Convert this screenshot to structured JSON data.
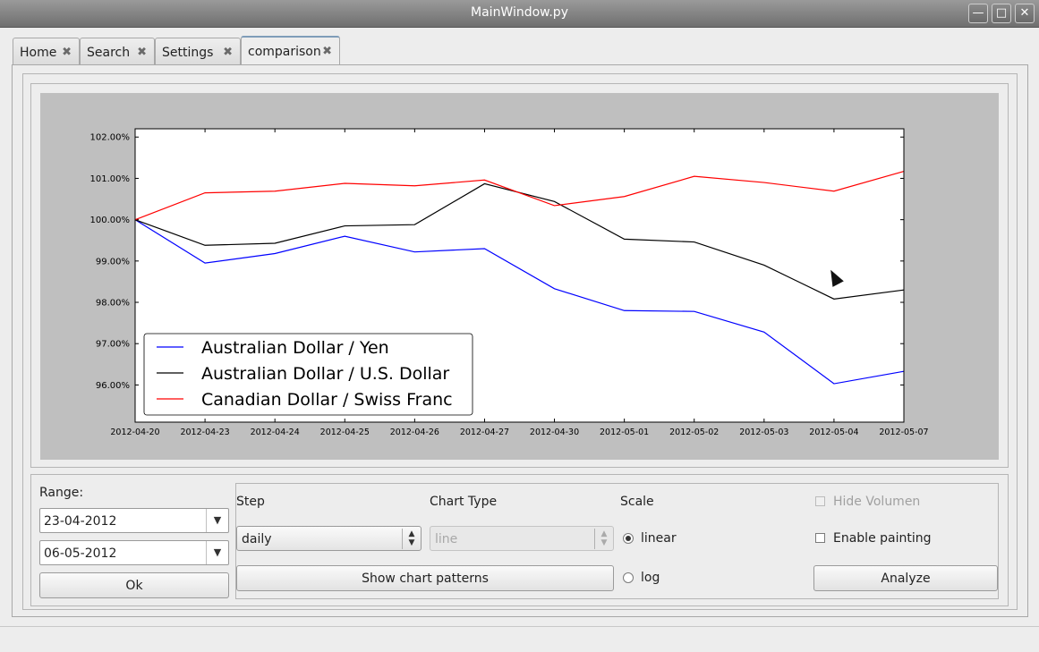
{
  "window": {
    "title": "MainWindow.py",
    "controls": [
      "minimize-icon",
      "maximize-icon",
      "close-icon"
    ]
  },
  "tabs": [
    {
      "label": "Home",
      "active": false
    },
    {
      "label": "Search",
      "active": false
    },
    {
      "label": "Settings",
      "active": false
    },
    {
      "label": "comparison",
      "active": true
    }
  ],
  "chart_data": {
    "type": "line",
    "x": [
      "2012-04-20",
      "2012-04-23",
      "2012-04-24",
      "2012-04-25",
      "2012-04-26",
      "2012-04-27",
      "2012-04-30",
      "2012-05-01",
      "2012-05-02",
      "2012-05-03",
      "2012-05-04",
      "2012-05-07"
    ],
    "yticks": [
      "102.00%",
      "101.00%",
      "100.00%",
      "99.00%",
      "98.00%",
      "97.00%",
      "96.00%"
    ],
    "ylim": [
      95.1,
      102.2
    ],
    "grid": false,
    "legend_position": "lower-left",
    "series": [
      {
        "name": "Australian Dollar / Yen",
        "color": "#0000ff",
        "values": [
          100.0,
          98.95,
          99.18,
          99.6,
          99.22,
          99.3,
          98.33,
          97.8,
          97.78,
          97.28,
          96.03,
          96.33
        ]
      },
      {
        "name": "Australian Dollar / U.S. Dollar",
        "color": "#000000",
        "values": [
          100.0,
          99.38,
          99.43,
          99.85,
          99.88,
          100.87,
          100.44,
          99.53,
          99.46,
          98.9,
          98.08,
          98.3
        ]
      },
      {
        "name": "Canadian Dollar / Swiss Franc",
        "color": "#ff0000",
        "values": [
          100.0,
          100.65,
          100.69,
          100.88,
          100.82,
          100.96,
          100.34,
          100.56,
          101.05,
          100.9,
          100.69,
          101.17
        ]
      }
    ]
  },
  "controls": {
    "range_label": "Range:",
    "range_from": "23-04-2012",
    "range_to": "06-05-2012",
    "ok_label": "Ok",
    "step_label": "Step",
    "step_value": "daily",
    "chart_type_label": "Chart Type",
    "chart_type_value": "line",
    "scale_label": "Scale",
    "scale_options": [
      "linear",
      "log"
    ],
    "scale_selected": "linear",
    "hide_volumen_label": "Hide Volumen",
    "enable_painting_label": "Enable painting",
    "show_patterns_label": "Show chart patterns",
    "analyze_label": "Analyze"
  }
}
